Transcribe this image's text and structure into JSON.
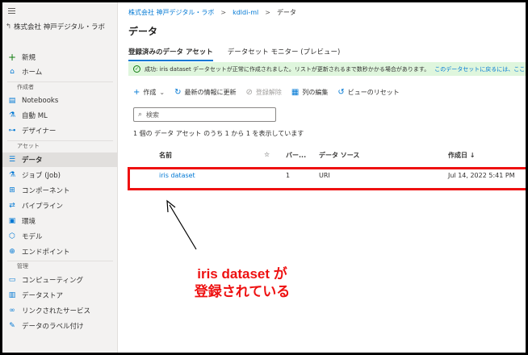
{
  "sidebar": {
    "workspace": "株式会社 神戸デジタル・ラボ",
    "items_top": [
      {
        "label": "新規",
        "icon": "plus-icon"
      },
      {
        "label": "ホーム",
        "icon": "home-icon"
      }
    ],
    "section_author": "作成者",
    "items_author": [
      {
        "label": "Notebooks",
        "icon": "notebook-icon"
      },
      {
        "label": "自動 ML",
        "icon": "automl-icon"
      },
      {
        "label": "デザイナー",
        "icon": "designer-icon"
      }
    ],
    "section_assets": "アセット",
    "items_assets": [
      {
        "label": "データ",
        "icon": "data-icon"
      },
      {
        "label": "ジョブ (Job)",
        "icon": "job-icon"
      },
      {
        "label": "コンポーネント",
        "icon": "component-icon"
      },
      {
        "label": "パイプライン",
        "icon": "pipeline-icon"
      },
      {
        "label": "環境",
        "icon": "environment-icon"
      },
      {
        "label": "モデル",
        "icon": "model-icon"
      },
      {
        "label": "エンドポイント",
        "icon": "endpoint-icon"
      }
    ],
    "section_manage": "管理",
    "items_manage": [
      {
        "label": "コンピューティング",
        "icon": "compute-icon"
      },
      {
        "label": "データストア",
        "icon": "datastore-icon"
      },
      {
        "label": "リンクされたサービス",
        "icon": "link-icon"
      },
      {
        "label": "データのラベル付け",
        "icon": "label-icon"
      }
    ]
  },
  "breadcrumb": [
    "株式会社 神戸デジタル・ラボ",
    "kdldi-ml",
    "データ"
  ],
  "page_title": "データ",
  "tabs": [
    "登録済みのデータ アセット",
    "データセット モニター (プレビュー)"
  ],
  "message": {
    "text": "成功: iris dataset データセットが正常に作成されました。リストが更新されるまで数秒かかる場合があります。",
    "link": "このデータセットに戻るには、ここを"
  },
  "toolbar": {
    "create": "作成",
    "refresh": "最新の情報に更新",
    "unregister": "登録解除",
    "edit_columns": "列の編集",
    "reset_view": "ビューのリセット"
  },
  "search": {
    "placeholder": "検索"
  },
  "count_text": "1 個の データ アセット のうち 1 から 1 を表示しています",
  "table": {
    "headers": {
      "name": "名前",
      "star": "☆",
      "version": "バー...",
      "source": "データ ソース",
      "created": "作成日 ↓"
    },
    "rows": [
      {
        "name": "iris dataset",
        "version": "1",
        "source": "URI",
        "created": "Jul 14, 2022 5:41 PM"
      }
    ]
  },
  "annotation": {
    "line1": "iris dataset が",
    "line2": "登録されている",
    "color": "#ee1111"
  }
}
